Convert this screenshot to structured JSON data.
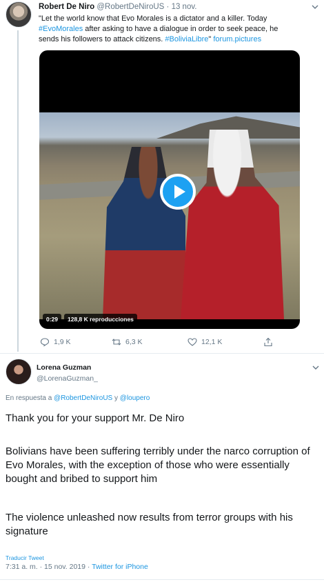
{
  "quoted_tweet": {
    "author_name": "Robert De Niro",
    "author_handle": "@RobertDeNiroUS",
    "separator": "·",
    "date": "13 nov.",
    "text_line1": "\"Let the world know that Evo Morales is a dictator and a killer. Today",
    "text_hashtag1": "#EvoMorales",
    "text_line2": " after asking to have a dialogue in order to seek peace, he",
    "text_line3_pre": "sends his followers to attack citizens. ",
    "text_hashtag2": "#BoliviaLibre",
    "text_line3_mid": "\" ",
    "text_link": "forum.pictures",
    "video": {
      "duration": "0:29",
      "views": "128,8 K reproducciones"
    },
    "actions": {
      "replies": "1,9 K",
      "retweets": "6,3 K",
      "likes": "12,1 K"
    },
    "icons": [
      "reply-icon",
      "retweet-icon",
      "like-icon",
      "share-icon",
      "chevron-down-icon",
      "play-icon"
    ]
  },
  "main_tweet": {
    "author_name": "Lorena Guzman",
    "author_handle": "@LorenaGuzman_",
    "reply_prefix": "En respuesta a ",
    "reply_user1": "@RobertDeNiroUS",
    "reply_joiner": " y ",
    "reply_user2": "@loupero",
    "paragraph1": "Thank you for your support Mr. De Niro",
    "paragraph2": "Bolivians have been suffering terribly under the narco corruption of Evo Morales, with the exception of those who were essentially bought and bribed to support him",
    "paragraph3": "The violence unleashed now results from terror groups with his signature",
    "translate_label": "Traducir Tweet",
    "timestamp": "7:31 a. m. · 15 nov. 2019",
    "meta_separator": " · ",
    "source": "Twitter for iPhone"
  },
  "colors": {
    "link": "#1b95e0",
    "play_button": "#1da1f2",
    "secondary_text": "#657786",
    "primary_text": "#14171a"
  }
}
